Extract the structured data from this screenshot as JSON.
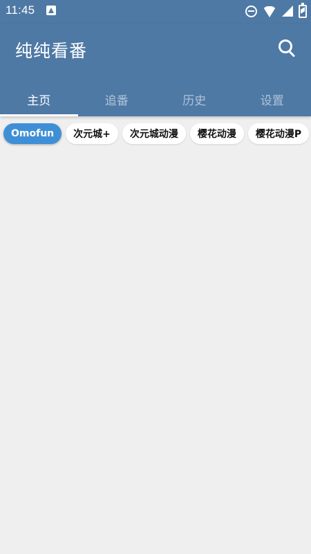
{
  "status_bar": {
    "time": "11:45",
    "icons": [
      "app-notification-icon",
      "do-not-disturb-icon",
      "wifi-icon",
      "cellular-signal-icon",
      "battery-charging-icon"
    ]
  },
  "app_bar": {
    "title": "纯纯看番",
    "search_icon": "search-icon",
    "background_color": "#4e79a5"
  },
  "tabs": [
    {
      "label": "主页",
      "active": true
    },
    {
      "label": "追番",
      "active": false
    },
    {
      "label": "历史",
      "active": false
    },
    {
      "label": "设置",
      "active": false
    }
  ],
  "sources": [
    {
      "label": "Omofun",
      "selected": true
    },
    {
      "label": "次元城+",
      "selected": false
    },
    {
      "label": "次元城动漫",
      "selected": false
    },
    {
      "label": "樱花动漫",
      "selected": false
    },
    {
      "label": "樱花动漫P",
      "selected": false
    }
  ],
  "colors": {
    "accent": "#3f8fd6",
    "background": "#efefef"
  }
}
